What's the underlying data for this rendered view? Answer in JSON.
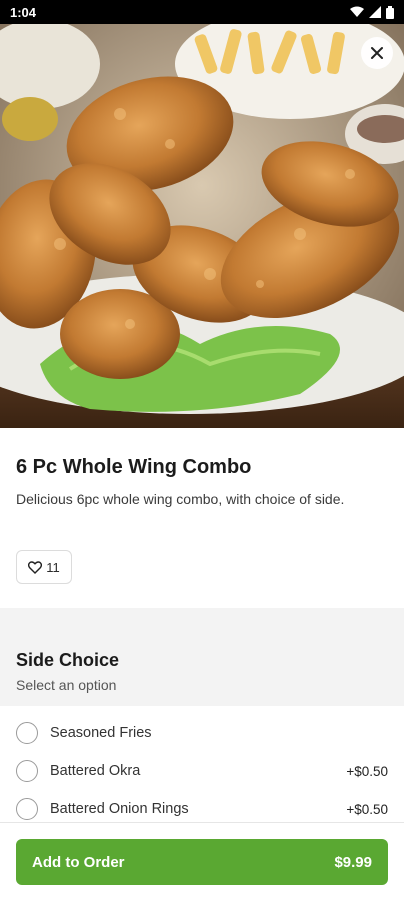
{
  "status_bar": {
    "time": "1:04"
  },
  "item": {
    "title": "6 Pc Whole Wing Combo",
    "description": "Delicious 6pc whole wing combo, with choice of side.",
    "likes": "11"
  },
  "section": {
    "title": "Side Choice",
    "subtitle": "Select an option",
    "options": [
      {
        "label": "Seasoned Fries",
        "price": ""
      },
      {
        "label": "Battered Okra",
        "price": "+$0.50"
      },
      {
        "label": "Battered Onion Rings",
        "price": "+$0.50"
      }
    ]
  },
  "cta": {
    "label": "Add to Order",
    "price": "$9.99"
  },
  "colors": {
    "accent": "#5aa832"
  }
}
